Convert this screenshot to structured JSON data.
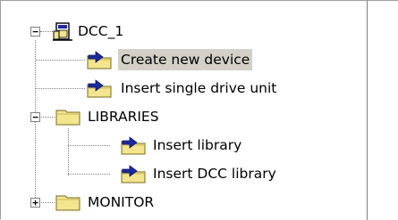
{
  "tree": {
    "root": {
      "label": "DCC_1",
      "expander": "−",
      "icon": "drive-device-icon"
    },
    "children": [
      {
        "label": "Create new device",
        "icon": "folder-insert-icon",
        "selected": true
      },
      {
        "label": "Insert single drive unit",
        "icon": "folder-insert-icon"
      },
      {
        "label": "LIBRARIES",
        "icon": "folder-icon",
        "expander": "−",
        "children": [
          {
            "label": "Insert library",
            "icon": "folder-insert-icon"
          },
          {
            "label": "Insert DCC library",
            "icon": "folder-insert-icon"
          }
        ]
      },
      {
        "label": "MONITOR",
        "icon": "folder-icon",
        "expander": "+"
      }
    ]
  },
  "colors": {
    "selection": "#d4d0c8",
    "folder": "#f3e58e",
    "arrow": "#1c2a9c",
    "lines": "#808080"
  }
}
